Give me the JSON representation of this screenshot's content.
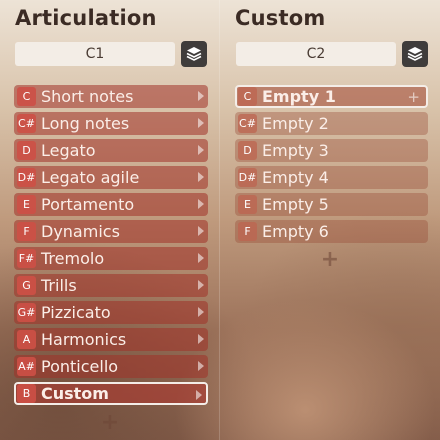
{
  "articulation": {
    "title": "Articulation",
    "preset": "C1",
    "items": [
      {
        "key": "C",
        "label": "Short notes"
      },
      {
        "key": "C#",
        "label": "Long notes"
      },
      {
        "key": "D",
        "label": "Legato"
      },
      {
        "key": "D#",
        "label": "Legato agile"
      },
      {
        "key": "E",
        "label": "Portamento"
      },
      {
        "key": "F",
        "label": "Dynamics"
      },
      {
        "key": "F#",
        "label": "Tremolo"
      },
      {
        "key": "G",
        "label": "Trills"
      },
      {
        "key": "G#",
        "label": "Pizzicato"
      },
      {
        "key": "A",
        "label": "Harmonics"
      },
      {
        "key": "A#",
        "label": "Ponticello"
      },
      {
        "key": "B",
        "label": "Custom"
      }
    ],
    "selected_index": 11,
    "add_symbol": "+"
  },
  "custom": {
    "title": "Custom",
    "preset": "C2",
    "items": [
      {
        "key": "C",
        "label": "Empty 1"
      },
      {
        "key": "C#",
        "label": "Empty 2"
      },
      {
        "key": "D",
        "label": "Empty 3"
      },
      {
        "key": "D#",
        "label": "Empty 4"
      },
      {
        "key": "E",
        "label": "Empty 5"
      },
      {
        "key": "F",
        "label": "Empty 6"
      }
    ],
    "selected_index": 0,
    "row_plus_symbol": "+",
    "add_symbol": "+"
  },
  "icons": {
    "layers": "layers-icon",
    "arrow": "chevron-right-icon",
    "add": "plus-icon"
  },
  "colors": {
    "row_fill": "#a03228",
    "key_badge": "#cd5046",
    "selected_border": "#f4ede8",
    "title_text": "#3b2b24",
    "preset_bg": "#f3ede6",
    "layers_button_bg": "#3f3c3b"
  }
}
